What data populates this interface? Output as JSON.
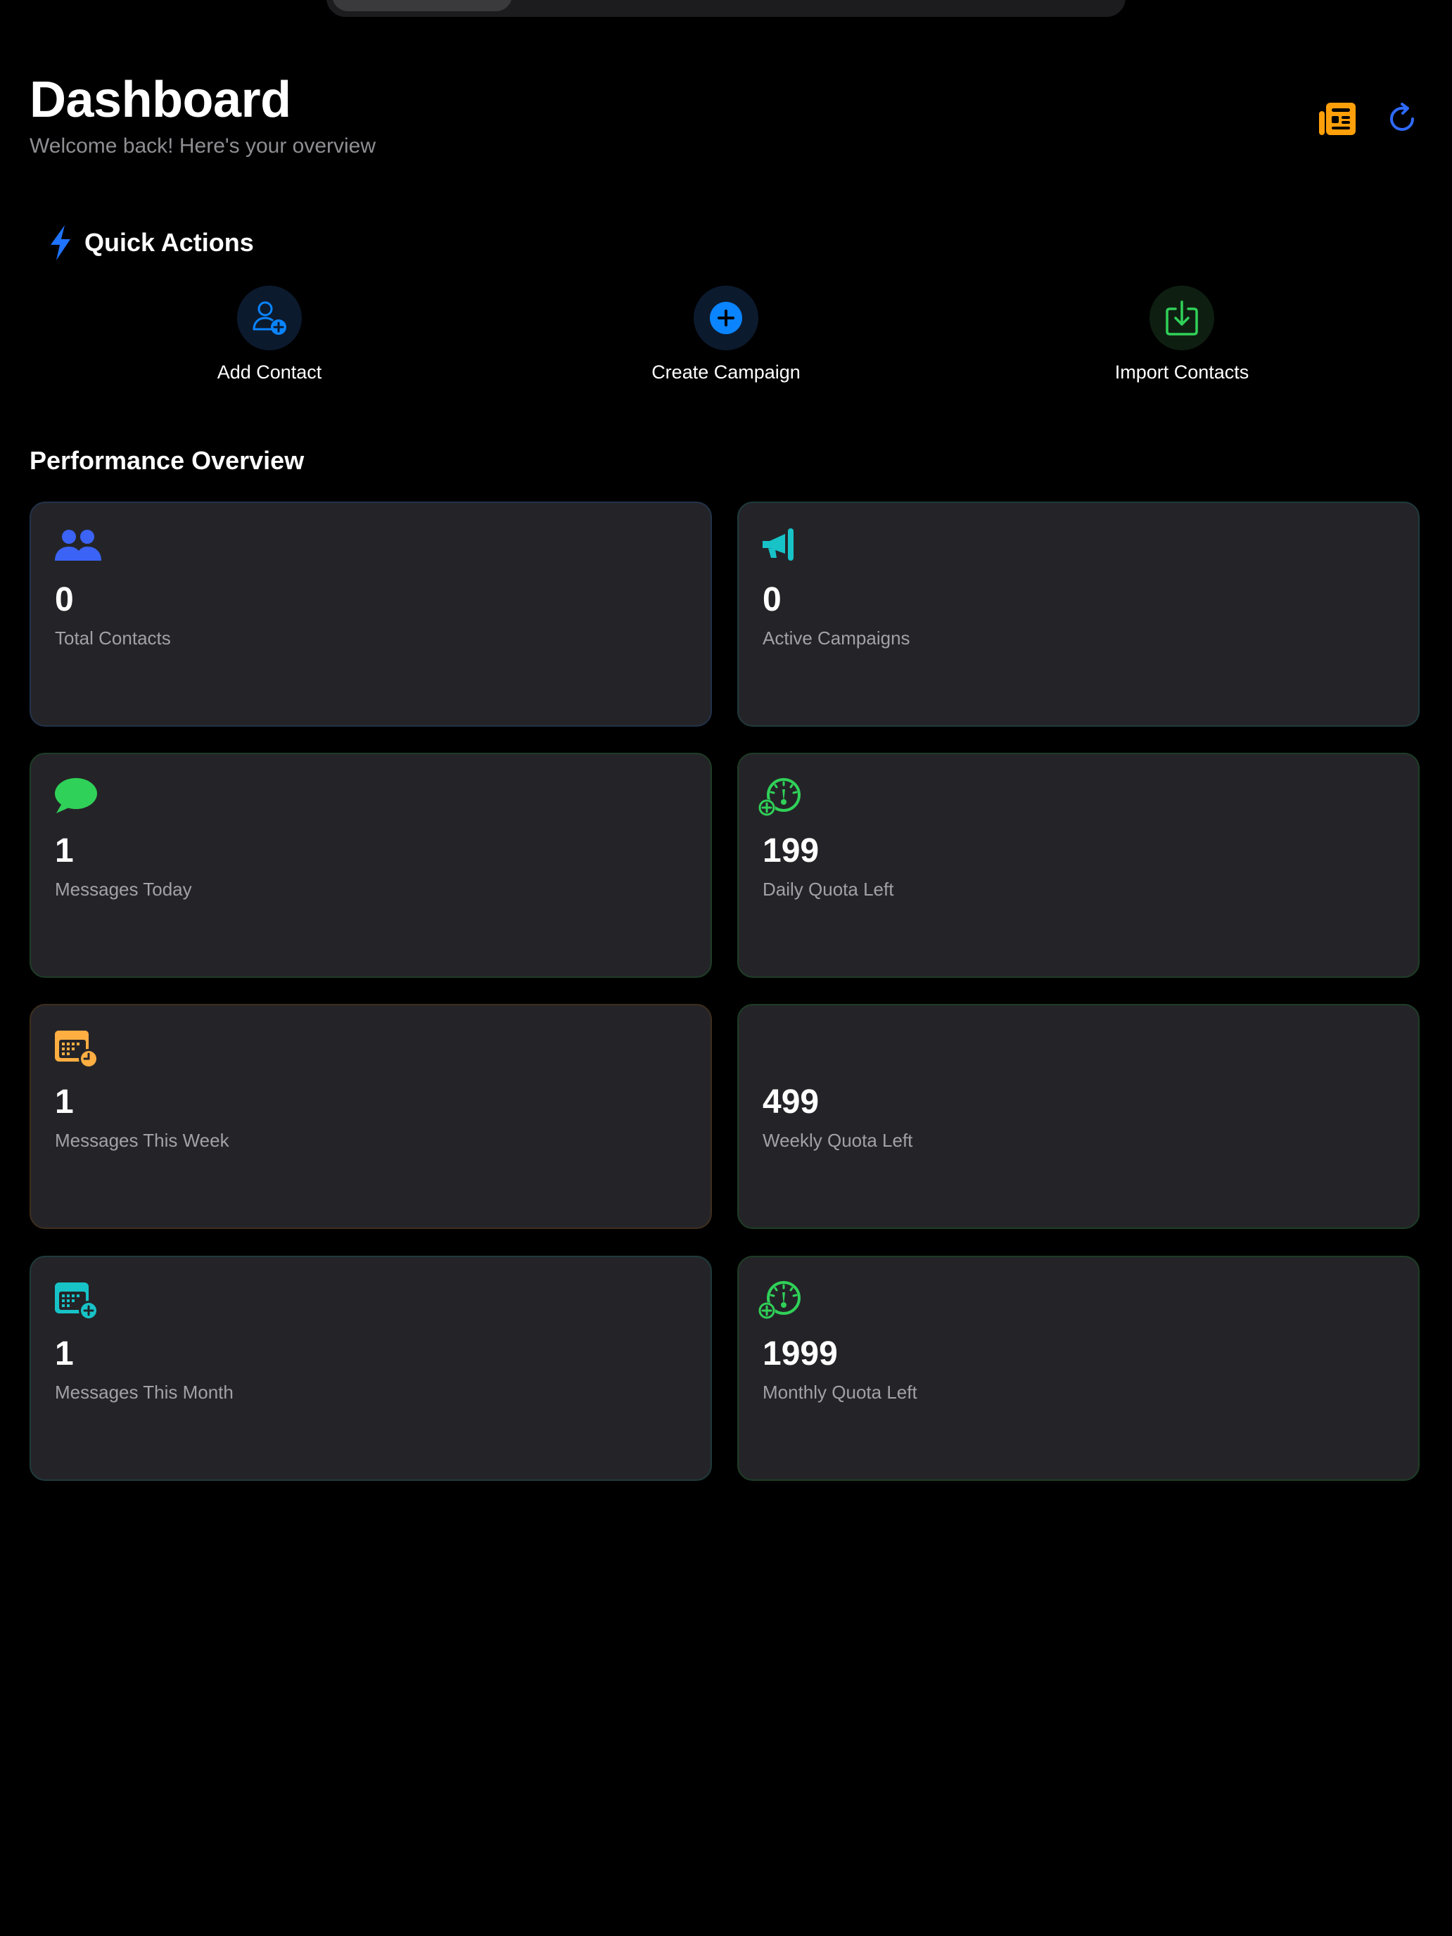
{
  "header": {
    "title": "Dashboard",
    "subtitle": "Welcome back! Here's your overview",
    "actions": [
      {
        "icon": "newspaper-icon",
        "color": "#ff9f0a"
      },
      {
        "icon": "refresh-icon",
        "color": "#2f6bff"
      }
    ]
  },
  "quick_actions": {
    "title": "Quick Actions",
    "icon": "bolt-icon",
    "items": [
      {
        "label": "Add Contact",
        "icon": "person-add-icon",
        "color": "#0a84ff"
      },
      {
        "label": "Create Campaign",
        "icon": "plus-circle-icon",
        "color": "#0a84ff"
      },
      {
        "label": "Import Contacts",
        "icon": "import-icon",
        "color": "#30d158"
      }
    ]
  },
  "performance": {
    "title": "Performance Overview",
    "cards": [
      {
        "value": "0",
        "label": "Total Contacts",
        "icon": "people-icon",
        "color": "#3b63f5"
      },
      {
        "value": "0",
        "label": "Active Campaigns",
        "icon": "megaphone-icon",
        "color": "#17c3c7"
      },
      {
        "value": "1",
        "label": "Messages Today",
        "icon": "chat-bubble-icon",
        "color": "#30d158"
      },
      {
        "value": "199",
        "label": "Daily Quota Left",
        "icon": "gauge-plus-icon",
        "color": "#30d158"
      },
      {
        "value": "1",
        "label": "Messages This Week",
        "icon": "calendar-clock-icon",
        "color": "#ffae42"
      },
      {
        "value": "499",
        "label": "Weekly Quota Left",
        "icon": "",
        "color": "#30d158"
      },
      {
        "value": "1",
        "label": "Messages This Month",
        "icon": "calendar-plus-icon",
        "color": "#17c3c7"
      },
      {
        "value": "1999",
        "label": "Monthly Quota Left",
        "icon": "gauge-plus-icon",
        "color": "#30d158"
      }
    ]
  }
}
